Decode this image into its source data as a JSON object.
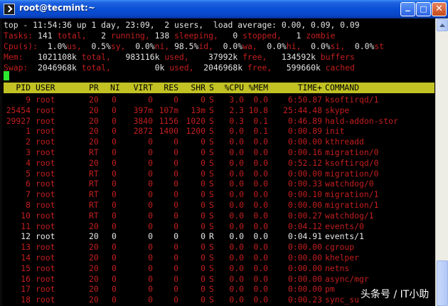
{
  "window": {
    "title": "root@tecmint:~",
    "minimize_label": "_",
    "maximize_label": "□",
    "close_label": "✕"
  },
  "summary": {
    "line1": "top - 11:54:36 up 1 day, 23:09,  2 users,  load average: 0.00, 0.09, 0.09",
    "tasks": {
      "prefix": "Tasks:",
      "total": " 141 ",
      "total_label": "total,",
      "running": "   2 ",
      "running_label": "running,",
      "sleeping": " 138 ",
      "sleeping_label": "sleeping,",
      "stopped": "   0 ",
      "stopped_label": "stopped,",
      "zombie": "   1 ",
      "zombie_label": "zombie"
    },
    "cpu": {
      "prefix": "Cpu(s):",
      "us": "  1.0%",
      "us_label": "us,",
      "sy": "  0.5%",
      "sy_label": "sy,",
      "ni": "  0.0%",
      "ni_label": "ni,",
      "id": " 98.5%",
      "id_label": "id,",
      "wa": "  0.0%",
      "wa_label": "wa,",
      "hi": "  0.0%",
      "hi_label": "hi,",
      "si": "  0.0%",
      "si_label": "si,",
      "st": "  0.0%",
      "st_label": "st"
    },
    "mem": {
      "prefix": "Mem:",
      "total": "   1021108k ",
      "total_label": "total,",
      "used": "   983116k ",
      "used_label": "used,",
      "free": "    37992k ",
      "free_label": "free,",
      "buffers": "   134592k ",
      "buffers_label": "buffers"
    },
    "swap": {
      "prefix": "Swap:",
      "total": "  2046968k ",
      "total_label": "total,",
      "used": "         0k ",
      "used_label": "used,",
      "free": "  2046968k ",
      "free_label": "free,",
      "cached": "   599660k ",
      "cached_label": "cached"
    }
  },
  "table": {
    "columns": [
      "PID",
      "USER",
      "PR",
      "NI",
      "VIRT",
      "RES",
      "SHR",
      "S",
      "%CPU",
      "%MEM",
      "TIME+",
      "COMMAND"
    ],
    "rows": [
      {
        "pid": "9",
        "user": "root",
        "pr": "20",
        "ni": "0",
        "virt": "0",
        "res": "0",
        "shr": "0",
        "s": "S",
        "cpu": "3.0",
        "mem": "0.0",
        "time": "6:50.87",
        "cmd": "ksoftirqd/1",
        "bright": false
      },
      {
        "pid": "25454",
        "user": "root",
        "pr": "20",
        "ni": "0",
        "virt": "397m",
        "res": "107m",
        "shr": "13m",
        "s": "S",
        "cpu": "2.3",
        "mem": "10.8",
        "time": "25:44.48",
        "cmd": "skype",
        "bright": false
      },
      {
        "pid": "29927",
        "user": "root",
        "pr": "20",
        "ni": "0",
        "virt": "3840",
        "res": "1156",
        "shr": "1020",
        "s": "S",
        "cpu": "0.3",
        "mem": "0.1",
        "time": "0:46.89",
        "cmd": "hald-addon-stor",
        "bright": false
      },
      {
        "pid": "1",
        "user": "root",
        "pr": "20",
        "ni": "0",
        "virt": "2872",
        "res": "1400",
        "shr": "1200",
        "s": "S",
        "cpu": "0.0",
        "mem": "0.1",
        "time": "0:00.89",
        "cmd": "init",
        "bright": false
      },
      {
        "pid": "2",
        "user": "root",
        "pr": "20",
        "ni": "0",
        "virt": "0",
        "res": "0",
        "shr": "0",
        "s": "S",
        "cpu": "0.0",
        "mem": "0.0",
        "time": "0:00.00",
        "cmd": "kthreadd",
        "bright": false
      },
      {
        "pid": "3",
        "user": "root",
        "pr": "RT",
        "ni": "0",
        "virt": "0",
        "res": "0",
        "shr": "0",
        "s": "S",
        "cpu": "0.0",
        "mem": "0.0",
        "time": "0:00.16",
        "cmd": "migration/0",
        "bright": false
      },
      {
        "pid": "4",
        "user": "root",
        "pr": "20",
        "ni": "0",
        "virt": "0",
        "res": "0",
        "shr": "0",
        "s": "S",
        "cpu": "0.0",
        "mem": "0.0",
        "time": "0:52.12",
        "cmd": "ksoftirqd/0",
        "bright": false
      },
      {
        "pid": "5",
        "user": "root",
        "pr": "RT",
        "ni": "0",
        "virt": "0",
        "res": "0",
        "shr": "0",
        "s": "S",
        "cpu": "0.0",
        "mem": "0.0",
        "time": "0:00.00",
        "cmd": "migration/0",
        "bright": false
      },
      {
        "pid": "6",
        "user": "root",
        "pr": "RT",
        "ni": "0",
        "virt": "0",
        "res": "0",
        "shr": "0",
        "s": "S",
        "cpu": "0.0",
        "mem": "0.0",
        "time": "0:00.33",
        "cmd": "watchdog/0",
        "bright": false
      },
      {
        "pid": "7",
        "user": "root",
        "pr": "RT",
        "ni": "0",
        "virt": "0",
        "res": "0",
        "shr": "0",
        "s": "S",
        "cpu": "0.0",
        "mem": "0.0",
        "time": "0:00.10",
        "cmd": "migration/1",
        "bright": false
      },
      {
        "pid": "8",
        "user": "root",
        "pr": "RT",
        "ni": "0",
        "virt": "0",
        "res": "0",
        "shr": "0",
        "s": "S",
        "cpu": "0.0",
        "mem": "0.0",
        "time": "0:00.00",
        "cmd": "migration/1",
        "bright": false
      },
      {
        "pid": "10",
        "user": "root",
        "pr": "RT",
        "ni": "0",
        "virt": "0",
        "res": "0",
        "shr": "0",
        "s": "S",
        "cpu": "0.0",
        "mem": "0.0",
        "time": "0:00.27",
        "cmd": "watchdog/1",
        "bright": false
      },
      {
        "pid": "11",
        "user": "root",
        "pr": "20",
        "ni": "0",
        "virt": "0",
        "res": "0",
        "shr": "0",
        "s": "S",
        "cpu": "0.0",
        "mem": "0.0",
        "time": "0:04.12",
        "cmd": "events/0",
        "bright": false
      },
      {
        "pid": "12",
        "user": "root",
        "pr": "20",
        "ni": "0",
        "virt": "0",
        "res": "0",
        "shr": "0",
        "s": "R",
        "cpu": "0.0",
        "mem": "0.0",
        "time": "0:04.91",
        "cmd": "events/1",
        "bright": true
      },
      {
        "pid": "13",
        "user": "root",
        "pr": "20",
        "ni": "0",
        "virt": "0",
        "res": "0",
        "shr": "0",
        "s": "S",
        "cpu": "0.0",
        "mem": "0.0",
        "time": "0:00.00",
        "cmd": "cgroup",
        "bright": false
      },
      {
        "pid": "14",
        "user": "root",
        "pr": "20",
        "ni": "0",
        "virt": "0",
        "res": "0",
        "shr": "0",
        "s": "S",
        "cpu": "0.0",
        "mem": "0.0",
        "time": "0:00.00",
        "cmd": "khelper",
        "bright": false
      },
      {
        "pid": "15",
        "user": "root",
        "pr": "20",
        "ni": "0",
        "virt": "0",
        "res": "0",
        "shr": "0",
        "s": "S",
        "cpu": "0.0",
        "mem": "0.0",
        "time": "0:00.00",
        "cmd": "netns",
        "bright": false
      },
      {
        "pid": "16",
        "user": "root",
        "pr": "20",
        "ni": "0",
        "virt": "0",
        "res": "0",
        "shr": "0",
        "s": "S",
        "cpu": "0.0",
        "mem": "0.0",
        "time": "0:00.00",
        "cmd": "async/mgr",
        "bright": false
      },
      {
        "pid": "17",
        "user": "root",
        "pr": "20",
        "ni": "0",
        "virt": "0",
        "res": "0",
        "shr": "0",
        "s": "S",
        "cpu": "0.0",
        "mem": "0.0",
        "time": "0:00.00",
        "cmd": "pm",
        "bright": false
      },
      {
        "pid": "18",
        "user": "root",
        "pr": "20",
        "ni": "0",
        "virt": "0",
        "res": "0",
        "shr": "0",
        "s": "S",
        "cpu": "0.0",
        "mem": "0.0",
        "time": "0:00.23",
        "cmd": "sync_su",
        "bright": false
      }
    ]
  },
  "watermark": "头条号 / IT小助",
  "colors": {
    "header_bar": "#c2c224",
    "process_text": "#c41e1e",
    "cursor": "#2ee82e",
    "titlebar": "#0a4fd6"
  }
}
